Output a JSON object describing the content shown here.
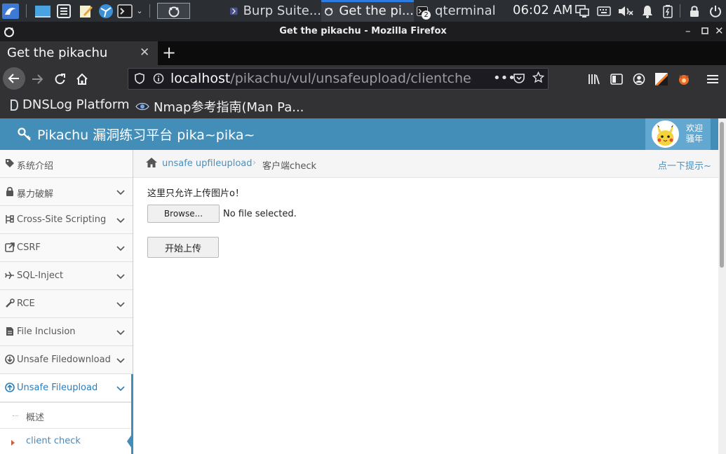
{
  "taskbar": {
    "tasks": [
      {
        "label": "Burp Suite..."
      },
      {
        "label": "Get the pi..."
      },
      {
        "label": "qterminal",
        "badge": "2"
      }
    ],
    "clock": "06:02 AM"
  },
  "window": {
    "title": "Get the pikachu - Mozilla Firefox"
  },
  "tab": {
    "title": "Get the pikachu",
    "close": "✕",
    "new_tab": "+"
  },
  "navbar": {
    "url_host": "localhost",
    "url_path": "/pikachu/vul/unsafeupload/clientcheck.php"
  },
  "bookmarks": [
    {
      "label": "DNSLog Platform"
    },
    {
      "label": "Nmap参考指南(Man Pa..."
    }
  ],
  "site": {
    "brand": "Pikachu 漏洞练习平台 pika~pika~",
    "user_line1": "欢迎",
    "user_line2": "骚年"
  },
  "sidebar": {
    "items": [
      {
        "label": "系统介绍",
        "icon": "tag-icon"
      },
      {
        "label": "暴力破解",
        "icon": "lock-icon"
      },
      {
        "label": "Cross-Site Scripting",
        "icon": "sitemap-icon"
      },
      {
        "label": "CSRF",
        "icon": "share-icon"
      },
      {
        "label": "SQL-Inject",
        "icon": "plane-icon"
      },
      {
        "label": "RCE",
        "icon": "wrench-icon"
      },
      {
        "label": "File Inclusion",
        "icon": "file-icon"
      },
      {
        "label": "Unsafe Filedownload",
        "icon": "download-icon"
      },
      {
        "label": "Unsafe Fileupload",
        "icon": "upload-icon"
      }
    ],
    "subitems": [
      {
        "label": "概述"
      },
      {
        "label": "client check"
      }
    ]
  },
  "breadcrumb": {
    "link": "unsafe upfileupload",
    "current": "客户端check",
    "hint": "点一下提示~"
  },
  "content": {
    "notice": "这里只允许上传图片o！",
    "browse_label": "Browse...",
    "file_status": "No file selected.",
    "upload_label": "开始上传"
  },
  "colors": {
    "header": "#438eb9",
    "accent": "#2b7dbc",
    "taskbar": "#2b2e33"
  }
}
